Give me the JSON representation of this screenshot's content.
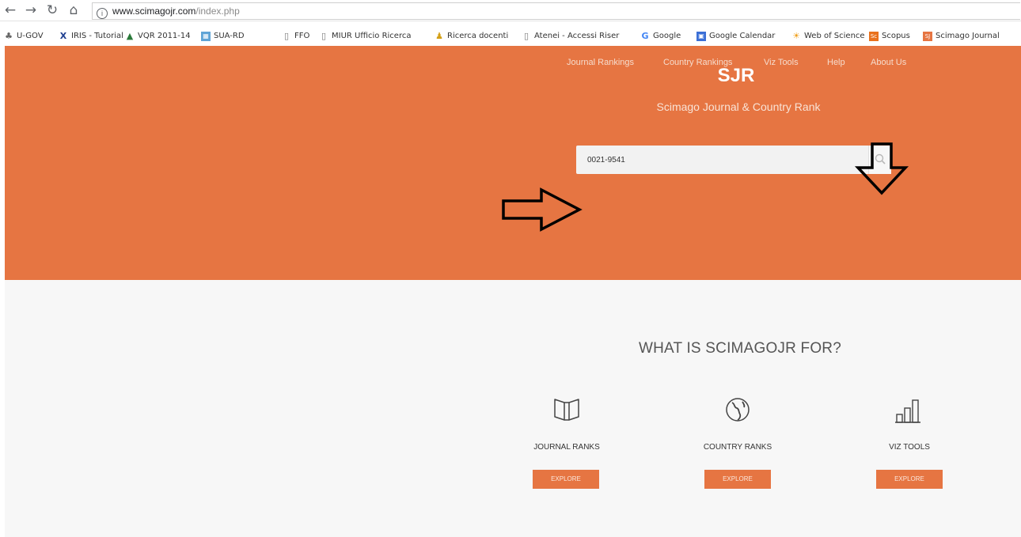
{
  "browser": {
    "url_host": "www.scimagojr.com",
    "url_path": "/index.php",
    "bookmarks": [
      {
        "label": "U-GOV",
        "icon": "u-gov-icon"
      },
      {
        "label": "IRIS - Tutorial",
        "icon": "iris-icon"
      },
      {
        "label": "VQR 2011-14",
        "icon": "vqr-icon"
      },
      {
        "label": "SUA-RD",
        "icon": "sua-rd-icon"
      },
      {
        "label": "FFO",
        "icon": "page-icon"
      },
      {
        "label": "MIUR Ufficio Ricerca",
        "icon": "page-icon"
      },
      {
        "label": "Ricerca docenti",
        "icon": "people-icon"
      },
      {
        "label": "Atenei - Accessi Riser",
        "icon": "page-icon"
      },
      {
        "label": "Google",
        "icon": "google-icon"
      },
      {
        "label": "Google Calendar",
        "icon": "calendar-icon"
      },
      {
        "label": "Web of Science",
        "icon": "wos-icon"
      },
      {
        "label": "Scopus",
        "icon": "scopus-icon"
      },
      {
        "label": "Scimago Journal",
        "icon": "scimago-icon"
      }
    ]
  },
  "nav": {
    "items": [
      "Journal Rankings",
      "Country Rankings",
      "Viz Tools",
      "Help",
      "About Us"
    ]
  },
  "hero": {
    "brand": "SJR",
    "tagline": "Scimago Journal & Country Rank",
    "search_value": "0021-9541"
  },
  "features": {
    "heading": "WHAT IS SCIMAGOJR FOR?",
    "items": [
      {
        "label": "JOURNAL RANKS",
        "icon": "book-icon",
        "button": "EXPLORE"
      },
      {
        "label": "COUNTRY RANKS",
        "icon": "globe-icon",
        "button": "EXPLORE"
      },
      {
        "label": "VIZ TOOLS",
        "icon": "bar-chart-icon",
        "button": "EXPLORE"
      }
    ]
  },
  "colors": {
    "brand_orange": "#e67542",
    "lower_background": "#f7f7f7"
  }
}
